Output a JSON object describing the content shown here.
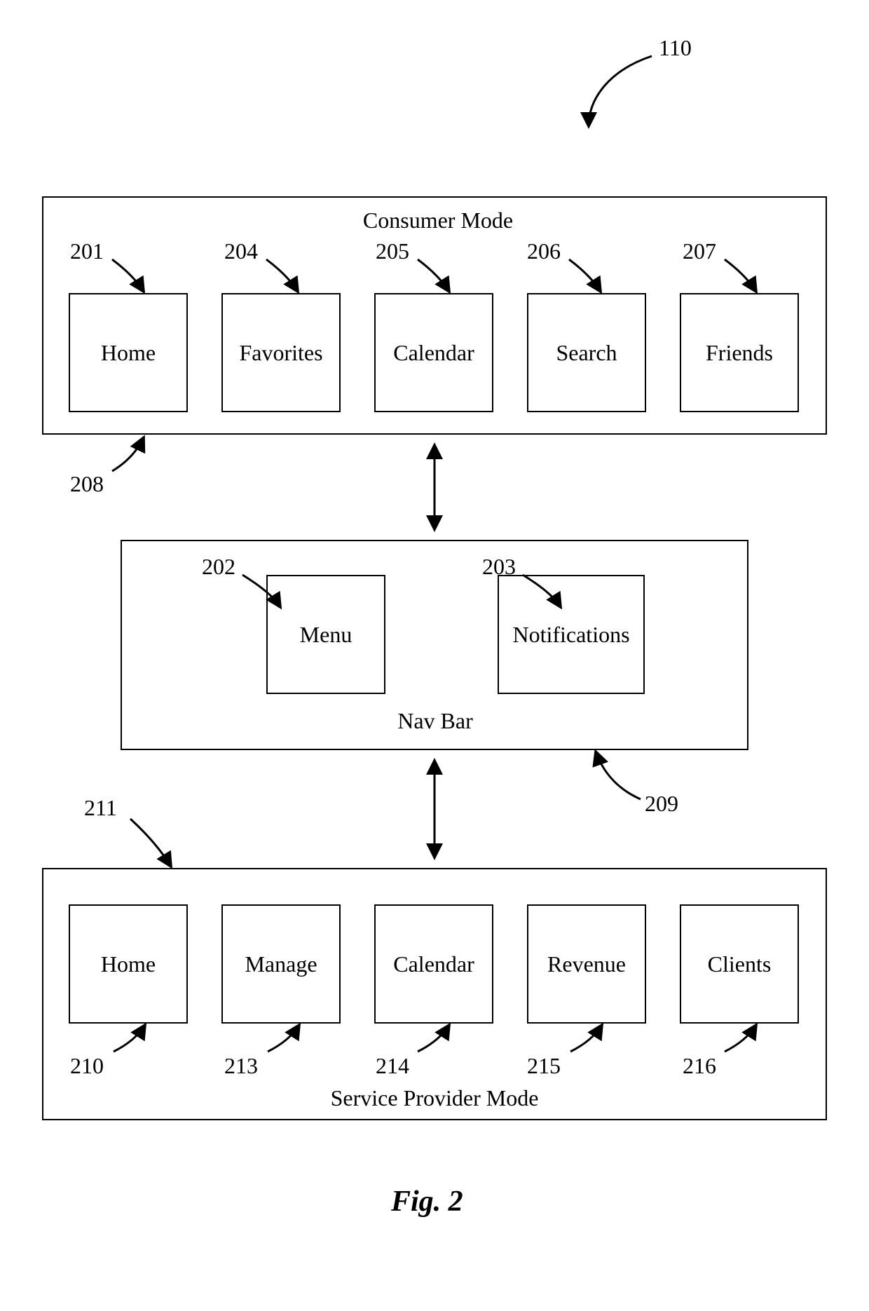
{
  "figure_ref": "110",
  "consumer_mode": {
    "title": "Consumer Mode",
    "panel_ref": "208",
    "items": [
      {
        "label": "Home",
        "ref": "201"
      },
      {
        "label": "Favorites",
        "ref": "204"
      },
      {
        "label": "Calendar",
        "ref": "205"
      },
      {
        "label": "Search",
        "ref": "206"
      },
      {
        "label": "Friends",
        "ref": "207"
      }
    ]
  },
  "nav_bar": {
    "title": "Nav Bar",
    "panel_ref": "209",
    "items": [
      {
        "label": "Menu",
        "ref": "202"
      },
      {
        "label": "Notifications",
        "ref": "203"
      }
    ]
  },
  "service_provider_mode": {
    "title": "Service Provider Mode",
    "panel_ref": "211",
    "items": [
      {
        "label": "Home",
        "ref": "210"
      },
      {
        "label": "Manage",
        "ref": "213"
      },
      {
        "label": "Calendar",
        "ref": "214"
      },
      {
        "label": "Revenue",
        "ref": "215"
      },
      {
        "label": "Clients",
        "ref": "216"
      }
    ]
  },
  "caption": "Fig. 2"
}
